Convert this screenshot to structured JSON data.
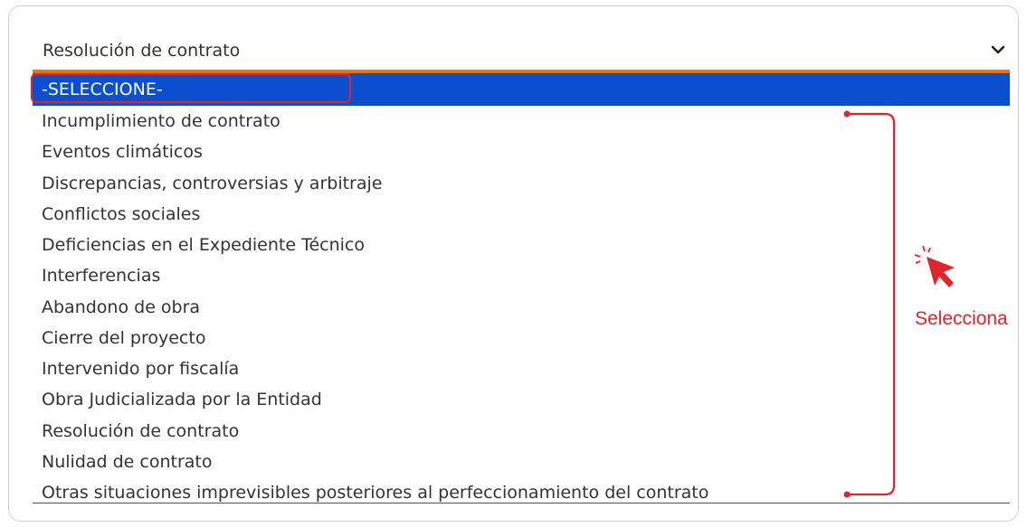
{
  "dropdown": {
    "selected_value": "Resolución de contrato",
    "options": [
      {
        "label": "-SELECCIONE-"
      },
      {
        "label": "Incumplimiento de contrato"
      },
      {
        "label": "Eventos climáticos"
      },
      {
        "label": "Discrepancias, controversias y arbitraje"
      },
      {
        "label": "Conflictos sociales"
      },
      {
        "label": "Deficiencias en el Expediente Técnico"
      },
      {
        "label": "Interferencias"
      },
      {
        "label": "Abandono de obra"
      },
      {
        "label": "Cierre del proyecto"
      },
      {
        "label": "Intervenido por fiscalía"
      },
      {
        "label": "Obra Judicializada por la Entidad"
      },
      {
        "label": "Resolución de contrato"
      },
      {
        "label": "Nulidad de contrato"
      },
      {
        "label": "Otras situaciones imprevisibles posteriores al perfeccionamiento del contrato"
      }
    ],
    "highlighted_index": 0
  },
  "annotation": {
    "text": "Selecciona",
    "color": "#e0252a",
    "icon": "cursor-click-icon"
  },
  "colors": {
    "accent_line": "#f07a1a",
    "selected_bg": "#0b4fcf"
  }
}
